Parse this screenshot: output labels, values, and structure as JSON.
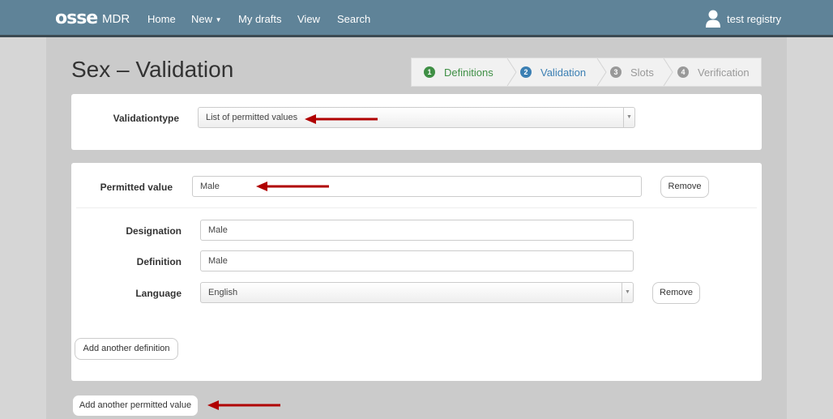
{
  "navbar": {
    "logo": "osse",
    "brand": "MDR",
    "items": [
      "Home",
      "New",
      "My drafts",
      "View",
      "Search"
    ],
    "user": "test registry"
  },
  "page": {
    "title": "Sex – Validation"
  },
  "steps": [
    {
      "num": "1",
      "label": "Definitions",
      "color": "#3f8f45"
    },
    {
      "num": "2",
      "label": "Validation",
      "color": "#3b7fb3"
    },
    {
      "num": "3",
      "label": "Slots",
      "color": "#999999"
    },
    {
      "num": "4",
      "label": "Verification",
      "color": "#999999"
    }
  ],
  "validation": {
    "label": "Validationtype",
    "value": "List of permitted values"
  },
  "permitted": {
    "label": "Permitted value",
    "value": "Male",
    "remove": "Remove",
    "designation_label": "Designation",
    "designation_value": "Male",
    "definition_label": "Definition",
    "definition_value": "Male",
    "language_label": "Language",
    "language_value": "English",
    "language_remove": "Remove",
    "add_definition": "Add another definition"
  },
  "actions": {
    "add_permitted": "Add another permitted value"
  },
  "colors": {
    "navbar": "#5f8398",
    "arrow": "#b00000"
  }
}
